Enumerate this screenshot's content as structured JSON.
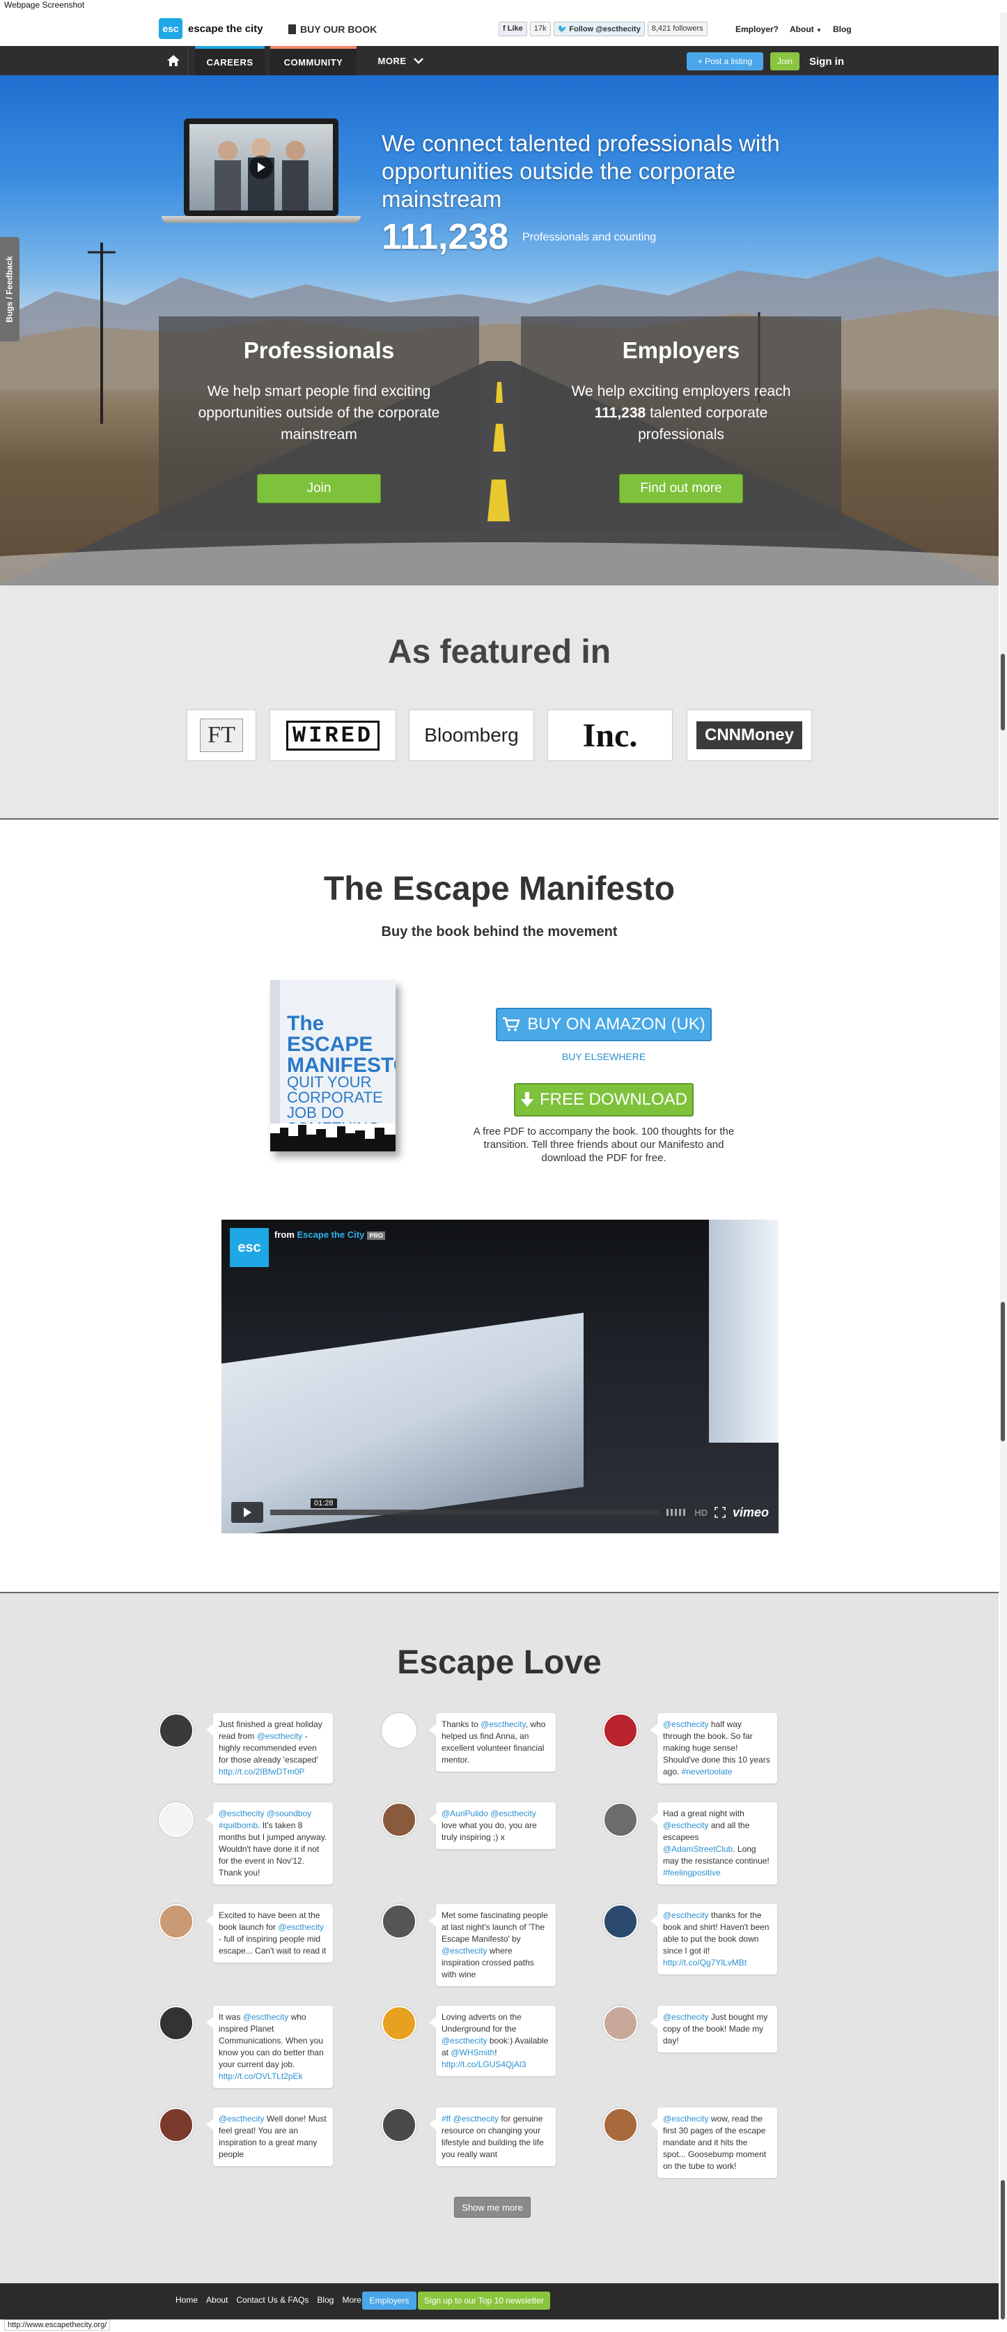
{
  "screenshot_label": "Webpage Screenshot",
  "header": {
    "logo_mark": "esc",
    "logo_text": "escape the city",
    "buy_book": "BUY OUR BOOK",
    "fb_like": "Like",
    "fb_count": "17k",
    "tw_follow": "Follow @escthecity",
    "tw_followers": "8,421 followers",
    "links": [
      "Employer?",
      "About",
      "Blog"
    ]
  },
  "nav": {
    "careers": "CAREERS",
    "community": "COMMUNITY",
    "more": "MORE",
    "post_listing": "+ Post a listing",
    "join": "Join",
    "sign_in": "Sign in"
  },
  "hero": {
    "feedback": "Bugs / Feedback",
    "headline": "We connect talented professionals with opportunities outside the corporate mainstream",
    "count": "111,238",
    "count_label": "Professionals and counting",
    "professionals": {
      "title": "Professionals",
      "text": "We help smart people find exciting opportunities outside of the corporate mainstream",
      "button": "Join"
    },
    "employers": {
      "title": "Employers",
      "text_before": "We help exciting employers reach",
      "count": "111,238",
      "text_after": "talented corporate professionals",
      "button": "Find out more"
    }
  },
  "featured": {
    "title": "As featured in",
    "logos": [
      "FT",
      "WIRED",
      "Bloomberg",
      "Inc.",
      "CNNMoney"
    ]
  },
  "manifesto": {
    "title": "The Escape Manifesto",
    "subtitle": "Buy the book behind the movement",
    "book_title": "The ESCAPE MANIFESTO",
    "book_sub": "QUIT YOUR CORPORATE JOB DO SOMETHING DIFFERENT",
    "amazon_button": "BUY ON AMAZON (UK)",
    "buy_elsewhere": "BUY ELSEWHERE",
    "download_button": "FREE DOWNLOAD",
    "download_text": "A free PDF to accompany the book. 100 thoughts for the transition. Tell three friends about our Manifesto and download the PDF for free.",
    "video": {
      "logo": "esc",
      "from": "from",
      "channel": "Escape the City",
      "pro": "PRO",
      "time": "01:28",
      "hd": "HD",
      "brand": "vimeo"
    }
  },
  "love": {
    "title": "Escape Love",
    "show_more": "Show me more",
    "tweets": [
      {
        "html": "Just finished a great holiday read from <a>@escthecity</a> - highly recommended even for those already 'escaped' <a>http://t.co/2IBfwDTm0P</a>",
        "avatar": "#3a3a3a"
      },
      {
        "html": "Thanks to <a>@escthecity</a>, who helped us find Anna, an excellent volunteer financial mentor.",
        "avatar": "#ffffff"
      },
      {
        "html": "<a>@escthecity</a> half way through the book. So far making huge sense! Should've done this 10 years ago. <a>#nevertoolate</a>",
        "avatar": "#b8232e"
      },
      {
        "html": "<a>@escthecity</a> <a>@soundboy</a> <a>#quitbomb</a>. It's taken 8 months but I jumped anyway. Wouldn't have done it if not for the event in Nov'12. Thank you!",
        "avatar": "#f4f4f4"
      },
      {
        "html": "<a>@AuriPulido</a> <a>@escthecity</a> love what you do, you are truly inspiring ;) x",
        "avatar": "#8a5a3c"
      },
      {
        "html": "Had a great night with <a>@escthecity</a> and all the escapees <a>@AdamStreetClub</a>. Long may the resistance continue! <a>#feelingpositive</a>",
        "avatar": "#6c6c6c"
      },
      {
        "html": "Excited to have been at the book launch for <a>@escthecity</a> - full of inspiring people mid escape... Can't wait to read it",
        "avatar": "#c99a74"
      },
      {
        "html": "Met some fascinating people at last night's launch of 'The Escape Manifesto' by <a>@escthecity</a> where inspiration crossed paths with wine",
        "avatar": "#555555"
      },
      {
        "html": "<a>@escthecity</a> thanks for the book and shirt! Haven't been able to put the book down since I got it! <a>http://t.co/Qg7YlLvMBt</a>",
        "avatar": "#2b4a6e"
      },
      {
        "html": "It was <a>@escthecity</a> who inspired Planet Communications. When you know you can do better than your current day job. <a>http://t.co/OVLTLt2pEk</a>",
        "avatar": "#333333"
      },
      {
        "html": "Loving adverts on the Underground for the <a>@escthecity</a> book:) Available at <a>@WHSmith</a>! <a>http://t.co/LGUS4QjAl3</a>",
        "avatar": "#e8a020"
      },
      {
        "html": "<a>@escthecity</a> Just bought my copy of the book! Made my day!",
        "avatar": "#c8a89a"
      },
      {
        "html": "<a>@escthecity</a> Well done! Must feel great! You are an inspiration to a great many people",
        "avatar": "#7a3b2c"
      },
      {
        "html": "<a>#ff</a> <a>@escthecity</a> for genuine resource on changing your lifestyle and building the life you really want",
        "avatar": "#4a4a4a"
      },
      {
        "html": "<a>@escthecity</a> wow, read the first 30 pages of the escape mandate and it hits the spot... Goosebump moment on the tube to work!",
        "avatar": "#a86a3c"
      }
    ]
  },
  "footer": {
    "links": [
      "Home",
      "About",
      "Contact Us & FAQs",
      "Blog",
      "More"
    ],
    "employers": "Employers",
    "newsletter": "Sign up to our Top 10 newsletter"
  },
  "status_url": "http://www.escapethecity.org/"
}
